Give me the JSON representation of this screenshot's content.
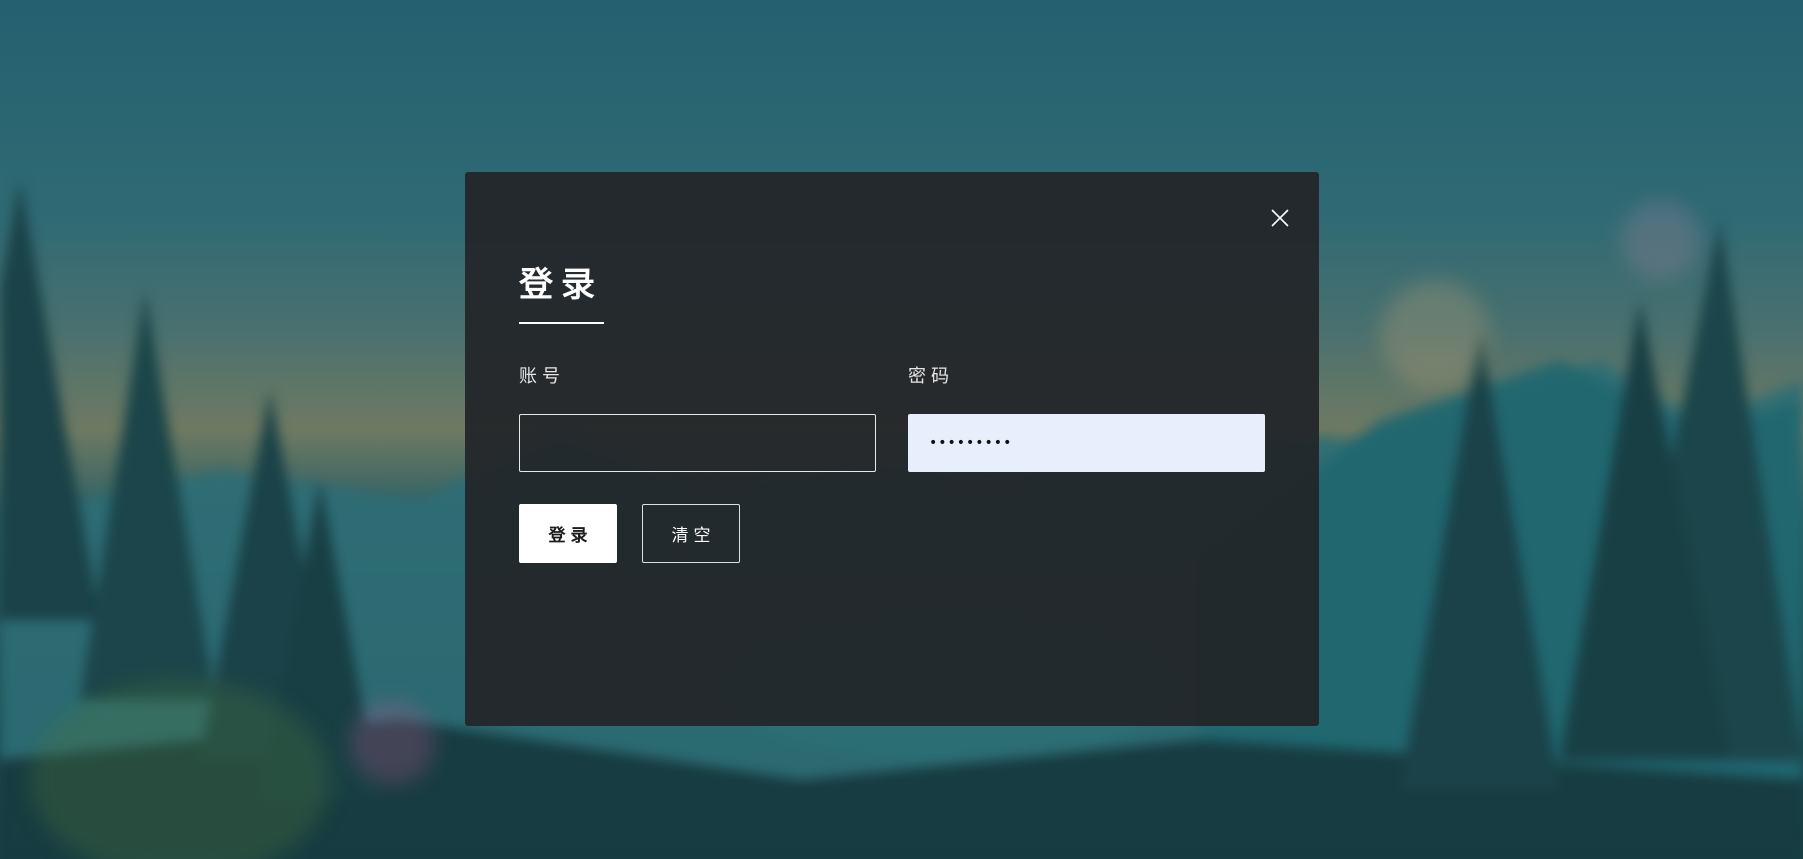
{
  "login_modal": {
    "title": "登录",
    "account_label": "账号",
    "account_value": "",
    "password_label": "密码",
    "password_value": "•••••••••",
    "login_button": "登录",
    "clear_button": "清空",
    "close_icon": "close-icon"
  },
  "colors": {
    "modal_background": "#222528",
    "primary_button": "#ffffff",
    "autofill_input": "#e7effc",
    "text": "#ffffff"
  }
}
